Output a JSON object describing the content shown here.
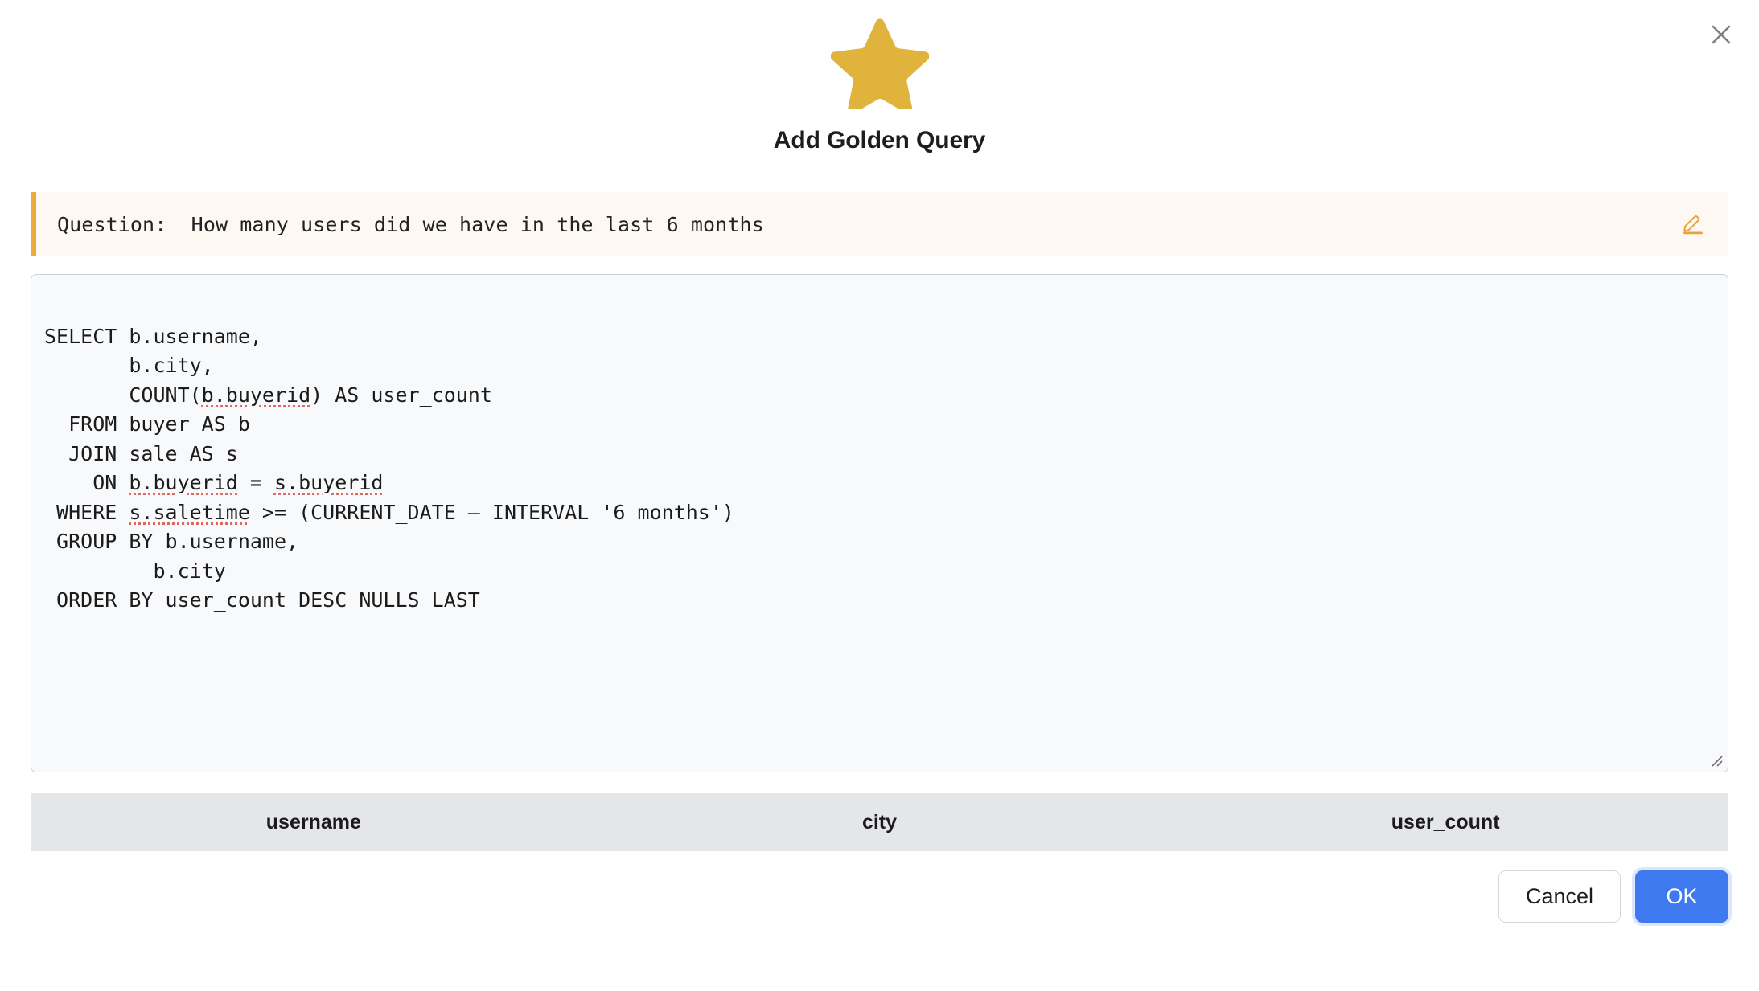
{
  "dialog": {
    "title": "Add Golden Query",
    "star_icon": "star-icon",
    "star_color": "#e0b33c",
    "close_icon": "close-icon"
  },
  "question": {
    "label": "Question:",
    "text": "How many users did we have in the last 6 months",
    "full": "Question:  How many users did we have in the last 6 months",
    "accent_color": "#eeab3c",
    "background_color": "#fdf9f2",
    "edit_icon": "edit-pencil-icon"
  },
  "sql_editor": {
    "value": "SELECT b.username,\n       b.city,\n       COUNT(b.buyerid) AS user_count\n  FROM buyer AS b\n  JOIN sale AS s\n    ON b.buyerid = s.buyerid\n WHERE s.saletime >= (CURRENT_DATE - INTERVAL '6 months')\n GROUP BY b.username,\n         b.city\n ORDER BY user_count DESC NULLS LAST",
    "lines": [
      {
        "pre": "SELECT b.username,"
      },
      {
        "pre": "       b.city,"
      },
      {
        "pre": "       COUNT(",
        "err": "b.buyerid",
        "post": ") AS user_count"
      },
      {
        "pre": "  FROM buyer AS b"
      },
      {
        "pre": "  JOIN sale AS s"
      },
      {
        "pre": "    ON ",
        "err": "b.buyerid",
        "post": " = ",
        "err2": "s.buyerid",
        "post2": ""
      },
      {
        "pre": " WHERE ",
        "err": "s.saletime",
        "post": " >= (CURRENT_DATE - INTERVAL '6 months')"
      },
      {
        "pre": " GROUP BY b.username,"
      },
      {
        "pre": "         b.city"
      },
      {
        "pre": " ORDER BY user_count DESC NULLS LAST"
      }
    ],
    "background_color": "#f8f9fb",
    "border_color": "#c9d3e0",
    "spellcheck_underline_color": "#e2685f"
  },
  "results": {
    "columns": [
      "username",
      "city",
      "user_count"
    ],
    "rows": [],
    "header_background": "#e4e6ea"
  },
  "footer": {
    "cancel_label": "Cancel",
    "ok_label": "OK",
    "ok_color": "#3f79f0"
  }
}
